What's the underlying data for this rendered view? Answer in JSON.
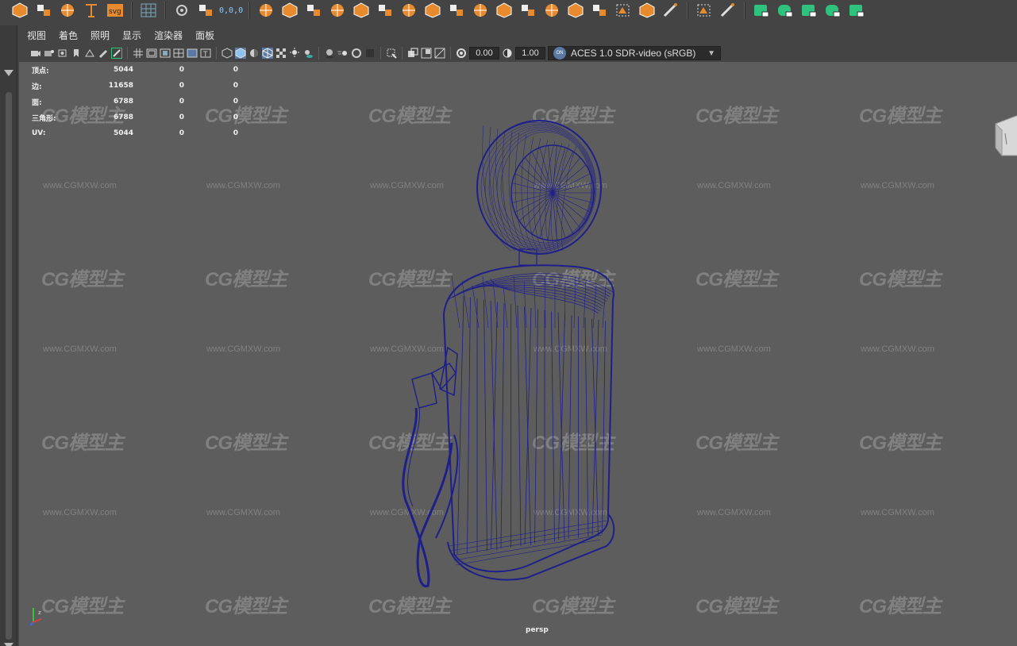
{
  "shelf": {
    "icons": [
      "poly-sphere-icon",
      "sparkle-icon",
      "curve-icon",
      "text-tool-icon",
      "svg-icon",
      "grid-icon",
      "camera-target-icon",
      "move-xyz-icon",
      "snap-icon",
      "bevel-icon",
      "cube-front-icon",
      "cube-multi-icon",
      "bridge-icon",
      "extrude-icon",
      "subdivide-icon",
      "merge-icon",
      "split-icon",
      "cube-open-icon",
      "cube-planar-icon",
      "cube-unfold-icon",
      "sphere-grid-icon",
      "cube-orange-icon",
      "cube-stack-icon",
      "triangle-select-icon",
      "sphere-orange-icon",
      "knife-icon",
      "select-box-icon",
      "brush-icon",
      "render-square-icon",
      "render-rounded-icon",
      "render-sphere-icon",
      "render-cube-icon",
      "render-flat-icon"
    ],
    "move_readout": "0,0,0"
  },
  "menu": [
    "视图",
    "着色",
    "照明",
    "显示",
    "渲染器",
    "面板"
  ],
  "toolbar": {
    "exposure": "0.00",
    "gamma": "1.00",
    "colorspace": "ACES 1.0 SDR-video (sRGB)",
    "colorspace_badge": "ON"
  },
  "hud": {
    "rows": [
      {
        "label": "顶点:",
        "v1": "5044",
        "v2": "0",
        "v3": "0"
      },
      {
        "label": "边:",
        "v1": "11658",
        "v2": "0",
        "v3": "0"
      },
      {
        "label": "面:",
        "v1": "6788",
        "v2": "0",
        "v3": "0"
      },
      {
        "label": "三角形:",
        "v1": "6788",
        "v2": "0",
        "v3": "0"
      },
      {
        "label": "UV:",
        "v1": "5044",
        "v2": "0",
        "v3": "0"
      }
    ]
  },
  "watermark": {
    "logo": "CG模型主",
    "url": "www.CGMXW.com"
  },
  "viewport": {
    "camera": "persp"
  },
  "colors": {
    "wire": "#1f1f8a",
    "viewport_bg": "#5d5d5d",
    "accent_green": "#2ec27e",
    "accent_orange": "#e88a2e"
  }
}
